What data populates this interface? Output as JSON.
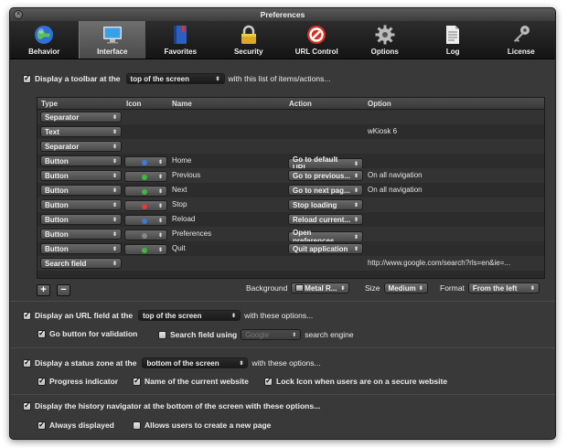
{
  "window": {
    "title": "Preferences"
  },
  "toolbar": {
    "items": [
      {
        "label": "Behavior",
        "icon": "globe-icon"
      },
      {
        "label": "Interface",
        "icon": "monitor-icon"
      },
      {
        "label": "Favorites",
        "icon": "book-icon"
      },
      {
        "label": "Security",
        "icon": "lock-icon"
      },
      {
        "label": "URL Control",
        "icon": "no-entry-icon"
      },
      {
        "label": "Options",
        "icon": "gear-icon"
      },
      {
        "label": "Log",
        "icon": "document-icon"
      },
      {
        "label": "License",
        "icon": "key-icon"
      }
    ],
    "selected": "Interface"
  },
  "toolbar_section": {
    "prefix": "Display a toolbar at the",
    "position": "top of the screen",
    "suffix": "with this list of items/actions...",
    "checked": true
  },
  "table": {
    "headers": {
      "type": "Type",
      "icon": "Icon",
      "name": "Name",
      "action": "Action",
      "option": "Option"
    },
    "rows": [
      {
        "type": "Separator",
        "icon": "",
        "name": "",
        "action": "",
        "option": ""
      },
      {
        "type": "Text",
        "icon": "",
        "name": "",
        "action": "",
        "option": "wKiosk 6"
      },
      {
        "type": "Separator",
        "icon": "",
        "name": "",
        "action": "",
        "option": ""
      },
      {
        "type": "Button",
        "icon": "home-icon",
        "icon_color": "#3a7bd5",
        "name": "Home",
        "action": "Go to default URL",
        "option": ""
      },
      {
        "type": "Button",
        "icon": "previous-icon",
        "icon_color": "#3fb83f",
        "name": "Previous",
        "action": "Go to previous...",
        "option": "On all navigation"
      },
      {
        "type": "Button",
        "icon": "next-icon",
        "icon_color": "#3fb83f",
        "name": "Next",
        "action": "Go to next pag...",
        "option": "On all navigation"
      },
      {
        "type": "Button",
        "icon": "stop-icon",
        "icon_color": "#e03a3a",
        "name": "Stop",
        "action": "Stop loading",
        "option": ""
      },
      {
        "type": "Button",
        "icon": "reload-icon",
        "icon_color": "#3a7bd5",
        "name": "Reload",
        "action": "Reload current...",
        "option": ""
      },
      {
        "type": "Button",
        "icon": "preferences-icon",
        "icon_color": "#888888",
        "name": "Preferences",
        "action": "Open preferences",
        "option": ""
      },
      {
        "type": "Button",
        "icon": "quit-icon",
        "icon_color": "#3fb83f",
        "name": "Quit",
        "action": "Quit application",
        "option": ""
      },
      {
        "type": "Search field",
        "icon": "",
        "name": "",
        "action": "",
        "option": "http://www.google.com/search?rls=en&ie=..."
      }
    ]
  },
  "table_controls": {
    "add": "+",
    "remove": "−",
    "background_label": "Background",
    "background_value": "Metal R...",
    "size_label": "Size",
    "size_value": "Medium",
    "format_label": "Format",
    "format_value": "From the left"
  },
  "url_section": {
    "prefix": "Display an URL field at the",
    "position": "top of the screen",
    "suffix": "with these options...",
    "checked": true,
    "go_button": "Go button for validation",
    "go_checked": true,
    "search_field": "Search field using",
    "search_checked": false,
    "search_engine": "Google",
    "search_suffix": "search engine"
  },
  "status_section": {
    "prefix": "Display a status zone at the",
    "position": "bottom of the screen",
    "suffix": "with these options...",
    "checked": true,
    "progress": "Progress indicator",
    "website_name": "Name of the current website",
    "lock_icon": "Lock Icon when users are on a secure website"
  },
  "history_section": {
    "label": "Display the history navigator at the bottom of the screen with these options...",
    "checked": true,
    "always": "Always displayed",
    "always_checked": true,
    "create_new": "Allows users to create a new page",
    "create_checked": false
  }
}
